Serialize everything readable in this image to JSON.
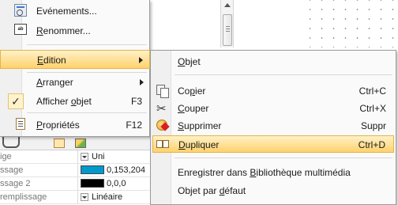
{
  "background": {
    "color": "#ffffff"
  },
  "main_menu": {
    "items": [
      {
        "label": "Evénements...",
        "underline": ""
      },
      {
        "label": "Renommer...",
        "underline": "R"
      },
      {
        "label": "Edition",
        "underline": "E",
        "highlighted": true,
        "submenu": true
      },
      {
        "label": "Arranger",
        "underline": "A",
        "submenu": true
      },
      {
        "label": "Afficher objet",
        "underline": "o",
        "shortcut": "F3",
        "checked": true
      },
      {
        "label": "Propriétés",
        "underline": "P",
        "shortcut": "F12"
      }
    ],
    "check_glyph": "✓"
  },
  "edition_submenu": {
    "items": [
      {
        "label": "Objet",
        "underline": "O"
      },
      {
        "label": "Copier",
        "underline": "p",
        "shortcut": "Ctrl+C",
        "icon": "copy-icon"
      },
      {
        "label": "Couper",
        "underline": "C",
        "shortcut": "Ctrl+X",
        "icon": "scissors-icon"
      },
      {
        "label": "Supprimer",
        "underline": "S",
        "shortcut": "Suppr",
        "icon": "delete-icon"
      },
      {
        "label": "Dupliquer",
        "underline": "D",
        "shortcut": "Ctrl+D",
        "icon": "duplicate-icon",
        "highlighted": true
      },
      {
        "label": "Enregistrer dans Bibliothèque multimédia",
        "underline": "B"
      },
      {
        "label": "Objet par défaut",
        "underline": "d"
      }
    ]
  },
  "property_grid": {
    "rows": [
      {
        "key": "ige",
        "value": "Uni",
        "type": "dropdown"
      },
      {
        "key": "ssage",
        "value": "0,153,204",
        "type": "color",
        "swatch": "#0099cc"
      },
      {
        "key": "ssage 2",
        "value": "0,0,0",
        "type": "color",
        "swatch": "#000000"
      },
      {
        "key": "remplissage",
        "value": "Linéaire",
        "type": "dropdown"
      }
    ]
  },
  "colors": {
    "highlight_top": "#fff1c8",
    "highlight_bottom": "#ffd26c",
    "highlight_border": "#e3b34e"
  }
}
